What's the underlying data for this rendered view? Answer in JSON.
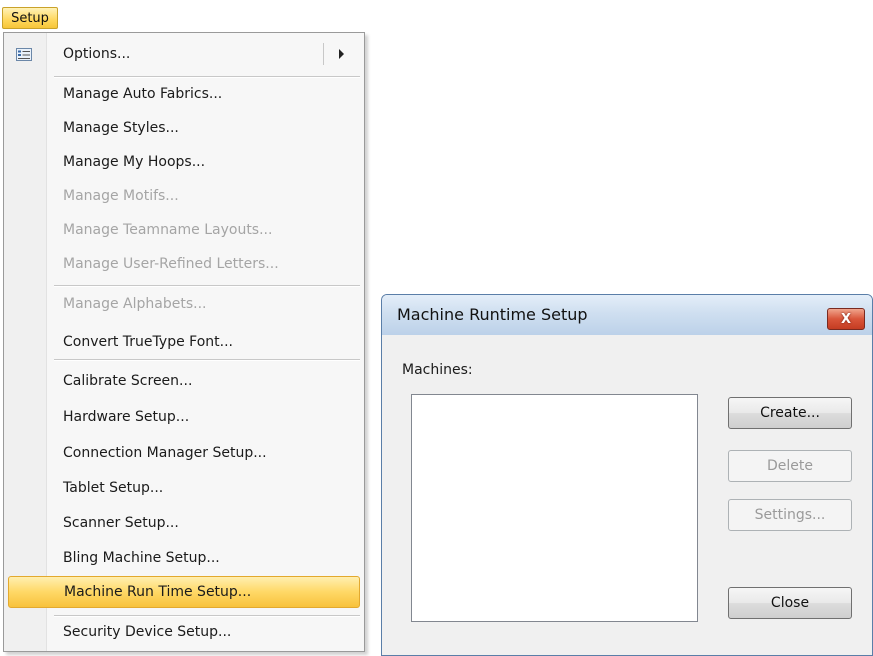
{
  "menubar": {
    "setup_label": "Setup"
  },
  "menu": {
    "items": [
      {
        "label": "Options...",
        "disabled": false,
        "has_submenu": true,
        "icon": "options-list-icon"
      },
      {
        "label": "Manage Auto Fabrics...",
        "disabled": false
      },
      {
        "label": "Manage Styles...",
        "disabled": false
      },
      {
        "label": "Manage My Hoops...",
        "disabled": false
      },
      {
        "label": "Manage Motifs...",
        "disabled": true
      },
      {
        "label": "Manage Teamname Layouts...",
        "disabled": true
      },
      {
        "label": "Manage User-Refined Letters...",
        "disabled": true
      },
      {
        "label": "Manage Alphabets...",
        "disabled": true
      },
      {
        "label": "Convert TrueType Font...",
        "disabled": false
      },
      {
        "label": "Calibrate Screen...",
        "disabled": false
      },
      {
        "label": "Hardware Setup...",
        "disabled": false
      },
      {
        "label": "Connection Manager Setup...",
        "disabled": false
      },
      {
        "label": "Tablet Setup...",
        "disabled": false
      },
      {
        "label": "Scanner Setup...",
        "disabled": false
      },
      {
        "label": "Bling Machine Setup...",
        "disabled": false
      },
      {
        "label": "Machine Run Time Setup...",
        "disabled": false,
        "highlighted": true
      },
      {
        "label": "Security Device Setup...",
        "disabled": false
      }
    ]
  },
  "dialog": {
    "title": "Machine Runtime Setup",
    "close_glyph": "X",
    "machines_label": "Machines:",
    "buttons": {
      "create": "Create...",
      "delete": "Delete",
      "settings": "Settings...",
      "close": "Close"
    }
  },
  "colors": {
    "highlight": "#ffd866",
    "disabled_text": "#a5a5a5",
    "close_button": "#d9553a",
    "titlebar": "#cfdff0"
  }
}
